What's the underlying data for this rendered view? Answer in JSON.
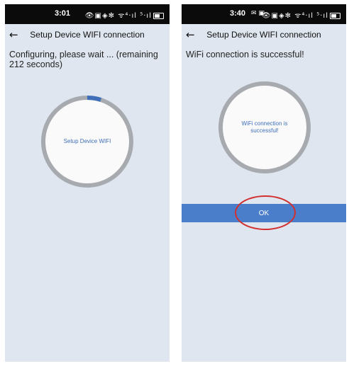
{
  "left_screen": {
    "status_bar": {
      "time": "3:01",
      "icons": "👁▣◈✻ ᯤ⁴·ıl ⁵·ıl"
    },
    "nav": {
      "back_icon": "←",
      "title": "Setup Device WIFI connection"
    },
    "message": "Configuring, please wait ... (remaining 212 seconds)",
    "ring": {
      "label": "Setup Device WIFI",
      "progress_fraction": 0.05,
      "progress_color": "#3f6fb8"
    }
  },
  "right_screen": {
    "status_bar": {
      "time": "3:40",
      "notification_icons": "✉ ▣",
      "icons": "👁▣◈✻ ᯤ⁴·ıl ⁵·ıl"
    },
    "nav": {
      "back_icon": "←",
      "title": "Setup Device WIFI connection"
    },
    "message": "WiFi connection is successful!",
    "ring": {
      "label": "WiFi connection is successful!"
    },
    "ok_button": {
      "label": "OK",
      "color": "#4a7ecb"
    },
    "highlight_color": "#d32f2f"
  }
}
